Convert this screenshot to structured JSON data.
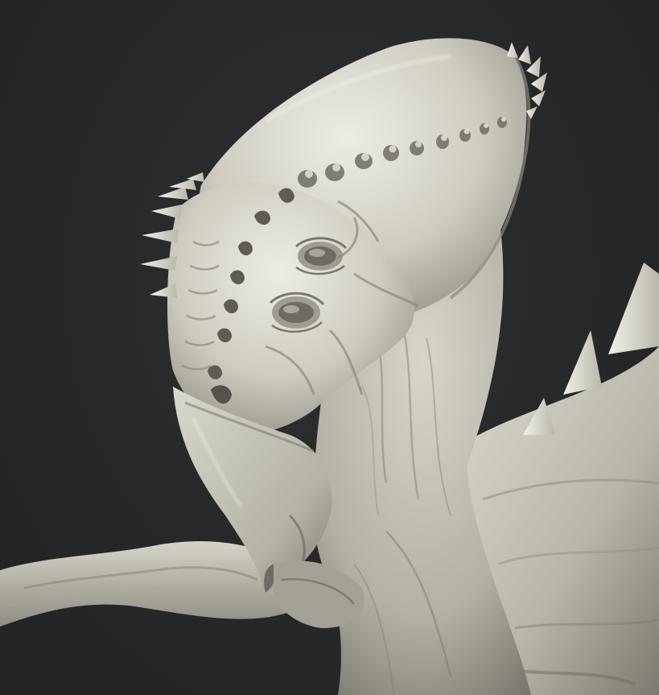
{
  "scene": {
    "subject": "creature-sculpt-render",
    "colors": {
      "background": "#262729",
      "clay_light": "#e9e8df",
      "clay_mid": "#c9c7bb",
      "clay_shadow": "#8f8d82",
      "clay_deep": "#5b5a52"
    }
  }
}
